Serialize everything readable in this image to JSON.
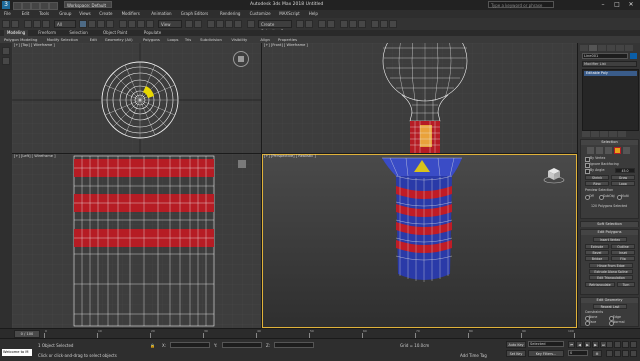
{
  "titlebar": {
    "app_icon": "3ds-max-logo",
    "workspace": "Workspace: Default",
    "title": "Autodesk 3ds Max 2018    Untitled",
    "search_placeholder": "Type a keyword or phrase",
    "minimize": "–",
    "maximize": "□",
    "close": "✕"
  },
  "menubar": {
    "items": [
      "File",
      "Edit",
      "Tools",
      "Group",
      "Views",
      "Create",
      "Modifiers",
      "Animation",
      "Graph Editors",
      "Rendering",
      "Customize",
      "MAXScript",
      "Help"
    ]
  },
  "toolbar": {
    "filter_dropdown": "All",
    "view_dropdown": "View",
    "selection_set": "Create Selection Se"
  },
  "ribbon": {
    "tabs": [
      "Modeling",
      "Freeform",
      "Selection",
      "Object Paint",
      "Populate"
    ],
    "active_tab": "Modeling",
    "items": [
      "Polygon Modeling",
      "Modify Selection",
      "Edit",
      "Geometry (All)",
      "Polygons",
      "Loops",
      "Tris",
      "Subdivision",
      "Visibility",
      "Align",
      "Properties"
    ]
  },
  "viewports": {
    "top": {
      "label": "[+] [Top] [ Wireframe ]"
    },
    "front": {
      "label": "[+] [Front] [ Wireframe ]"
    },
    "left": {
      "label": "[+] [Left] [ Wireframe ]"
    },
    "perspective": {
      "label": "[+] [Perspective] [ Realistic ]"
    }
  },
  "command_panel": {
    "object_name": "Line001",
    "object_color": "#0a5ea8",
    "modifier_list": "Modifier List",
    "stack_item": "Editable Poly",
    "rollouts": {
      "selection": {
        "title": "Selection",
        "by_vertex": "By Vertex",
        "ignore_backfacing": "Ignore Backfacing",
        "by_angle": "By Angle:",
        "angle_value": "45.0",
        "shrink": "Shrink",
        "grow": "Grow",
        "ring": "Ring",
        "loop": "Loop",
        "preview_selection": "Preview Selection",
        "off": "Off",
        "subobj": "SubObj",
        "multi": "Multi",
        "polygons_selected": "120 Polygons Selected"
      },
      "soft_selection": {
        "title": "Soft Selection"
      },
      "edit_polygons": {
        "title": "Edit Polygons",
        "insert_vertex": "Insert Vertex",
        "extrude": "Extrude",
        "outline": "Outline",
        "bevel": "Bevel",
        "inset": "Inset",
        "bridge": "Bridge",
        "flip": "Flip",
        "hinge_from_edge": "Hinge From Edge",
        "extrude_along_spline": "Extrude Along Spline",
        "edit_triangulation": "Edit Triangulation",
        "retriangulate": "Retriangulate",
        "turn": "Turn"
      },
      "edit_geometry": {
        "title": "Edit Geometry",
        "repeat_last": "Repeat Last",
        "constraints": "Constraints",
        "none": "None",
        "edge": "Edge",
        "face": "Face",
        "normal": "Normal",
        "preserve_uvs": "Preserve UVs",
        "create": "Create",
        "collapse": "Collapse"
      }
    }
  },
  "timeline": {
    "slider": "0 / 100",
    "ticks": [
      "0",
      "10",
      "20",
      "30",
      "40",
      "50",
      "60",
      "70",
      "80",
      "90",
      "100"
    ]
  },
  "statusbar": {
    "maxscript": "Welcome to M",
    "selection_status": "1 Object Selected",
    "prompt": "Click or click-and-drag to select objects",
    "x_label": "X:",
    "y_label": "Y:",
    "z_label": "Z:",
    "grid": "Grid = 10.0cm",
    "add_time_tag": "Add Time Tag",
    "auto_key": "Auto Key",
    "selected": "Selected",
    "set_key": "Set Key",
    "key_filters": "Key Filters...",
    "frame": "0"
  }
}
